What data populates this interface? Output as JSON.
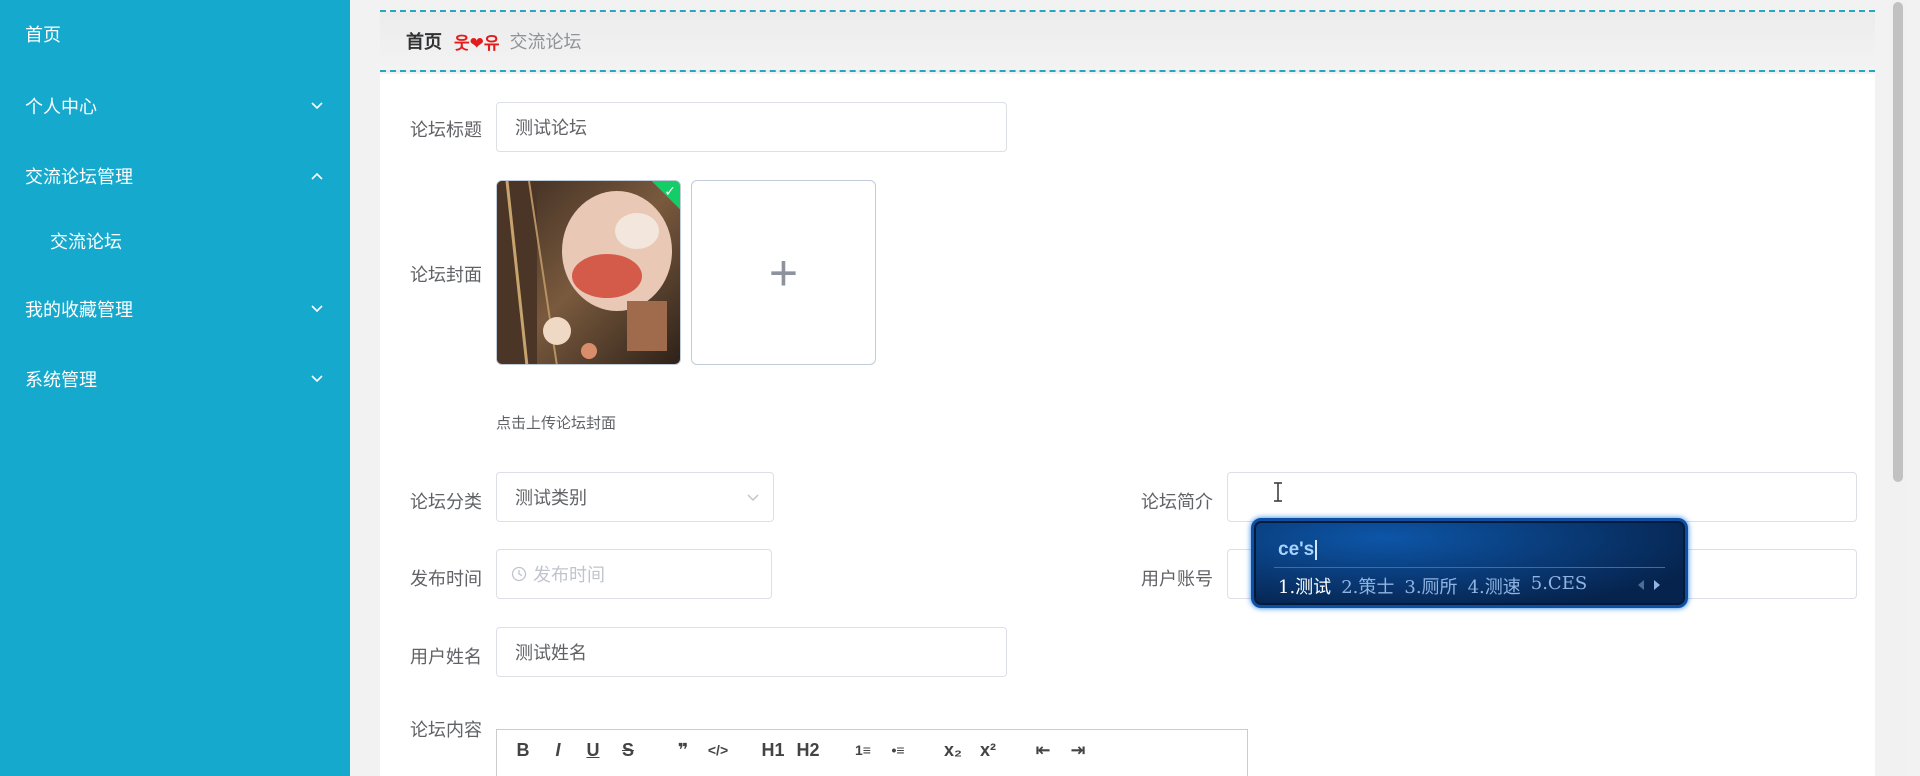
{
  "sidebar": {
    "items": [
      {
        "label": "首页"
      },
      {
        "label": "个人中心"
      },
      {
        "label": "交流论坛管理"
      },
      {
        "label": "交流论坛"
      },
      {
        "label": "我的收藏管理"
      },
      {
        "label": "系统管理"
      }
    ]
  },
  "breadcrumb": {
    "home": "首页",
    "separator": "웃❤유",
    "current": "交流论坛"
  },
  "form": {
    "title_label": "论坛标题",
    "title_value": "测试论坛",
    "cover_label": "论坛封面",
    "upload_tip": "点击上传论坛封面",
    "upload_add_icon": "+",
    "category_label": "论坛分类",
    "category_value": "测试类别",
    "intro_label": "论坛简介",
    "intro_value": "",
    "time_label": "发布时间",
    "time_placeholder": "发布时间",
    "account_label": "用户账号",
    "name_label": "用户姓名",
    "name_value": "测试姓名",
    "content_label": "论坛内容"
  },
  "editor_toolbar": [
    "B",
    "I",
    "U",
    "S",
    "❞",
    "</>",
    "H1",
    "H2",
    "1≡",
    "•≡",
    "x₂",
    "x²",
    "⇤",
    "⇥"
  ],
  "ime": {
    "composition": "ce's",
    "candidates": [
      "1.测试",
      "2.策士",
      "3.厕所",
      "4.测速",
      "5.CES"
    ]
  },
  "colors": {
    "sidebar_bg": "#15a9cd",
    "breadcrumb_border": "#27a6c0",
    "breadcrumb_separator": "#e21b1b",
    "upload_success": "#13ce66"
  }
}
